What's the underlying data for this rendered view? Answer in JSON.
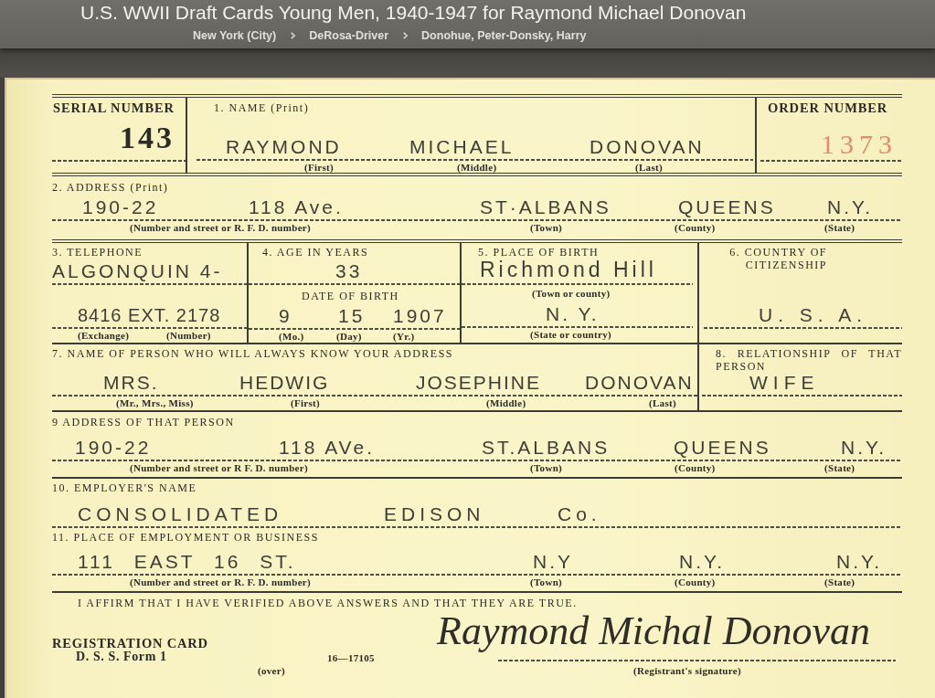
{
  "header": {
    "title": "U.S. WWII Draft Cards Young Men, 1940-1947 for Raymond Michael Donovan",
    "breadcrumbs": [
      "New York (City)",
      "DeRosa-Driver",
      "Donohue, Peter-Donsky, Harry"
    ]
  },
  "card": {
    "serial_number": {
      "label": "SERIAL NUMBER",
      "lines": [
        {
          "values": [
            "143"
          ]
        }
      ]
    },
    "name": {
      "label": "1. NAME (Print)",
      "lines": [
        {
          "values": [
            "RAYMOND",
            "MICHAEL",
            "DONOVAN"
          ],
          "captions": [
            "(First)",
            "(Middle)",
            "(Last)"
          ]
        }
      ]
    },
    "order_number": {
      "label": "ORDER NUMBER",
      "lines": [
        {
          "values": [
            "1373"
          ]
        }
      ]
    },
    "address": {
      "label": "2. ADDRESS (Print)",
      "lines": [
        {
          "values": [
            "190-22",
            "118 Ave.",
            "ST·ALBANS",
            "QUEENS",
            "N.Y."
          ],
          "captions": [
            "(Number and street or R. F. D. number)",
            "(Town)",
            "(County)",
            "(State)"
          ]
        }
      ]
    },
    "telephone": {
      "label": "3. TELEPHONE",
      "lines": [
        {
          "values": [
            "ALGONQUIN 4-"
          ]
        },
        {
          "values": [
            "8416 EXT. 2178"
          ],
          "captions": [
            "(Exchange)",
            "(Number)"
          ]
        }
      ]
    },
    "age": {
      "label": "4. AGE IN YEARS",
      "lines": [
        {
          "values": [
            "33"
          ]
        },
        {
          "heading": "DATE OF BIRTH",
          "values": [
            "9",
            "15",
            "1907"
          ],
          "captions": [
            "(Mo.)",
            "(Day)",
            "(Yr.)"
          ]
        }
      ]
    },
    "birthplace": {
      "label": "5. PLACE OF BIRTH",
      "lines": [
        {
          "values": [
            "Richmond Hill"
          ],
          "captions": [
            "(Town or county)"
          ]
        },
        {
          "values": [
            "N. Y."
          ],
          "captions": [
            "(State or country)"
          ]
        }
      ]
    },
    "citizenship": {
      "label": "6. COUNTRY OF CITIZENSHIP",
      "lines": [
        {
          "values": [
            "U. S. A."
          ]
        }
      ]
    },
    "contact_name": {
      "label": "7. NAME OF PERSON WHO WILL ALWAYS KNOW YOUR ADDRESS",
      "lines": [
        {
          "values": [
            "MRS.",
            "HEDWIG",
            "JOSEPHINE",
            "DONOVAN"
          ],
          "captions": [
            "(Mr., Mrs., Miss)",
            "(First)",
            "(Middle)",
            "(Last)"
          ]
        }
      ]
    },
    "relationship": {
      "label": "8. RELATIONSHIP OF THAT PERSON",
      "lines": [
        {
          "values": [
            "WIFE"
          ]
        }
      ]
    },
    "contact_address": {
      "label": "9 ADDRESS OF THAT PERSON",
      "lines": [
        {
          "values": [
            "190-22",
            "118 AVe.",
            "ST.ALBANS",
            "QUEENS",
            "N.Y."
          ],
          "captions": [
            "(Number and street or R F. D. number)",
            "(Town)",
            "(County)",
            "(State)"
          ]
        }
      ]
    },
    "employer": {
      "label": "10. EMPLOYER'S NAME",
      "lines": [
        {
          "values": [
            "CONSOLIDATED",
            "EDISON",
            "Co."
          ]
        }
      ]
    },
    "workplace": {
      "label": "11. PLACE OF EMPLOYMENT OR BUSINESS",
      "lines": [
        {
          "values": [
            "111 EAST 16 ST.",
            "N.Y",
            "N.Y.",
            "N.Y."
          ],
          "captions": [
            "(Number and street or R. F. D. number)",
            "(Town)",
            "(County)",
            "(State)"
          ]
        }
      ]
    },
    "affirmation": "I AFFIRM THAT I HAVE VERIFIED ABOVE ANSWERS AND THAT THEY ARE TRUE.",
    "form_title": "REGISTRATION CARD",
    "form_number": "D. S. S. Form 1",
    "over_note": "(over)",
    "print_code": "16—17105",
    "signature": "Raymond Michal Donovan",
    "signature_caption": "(Registrant's signature)"
  }
}
